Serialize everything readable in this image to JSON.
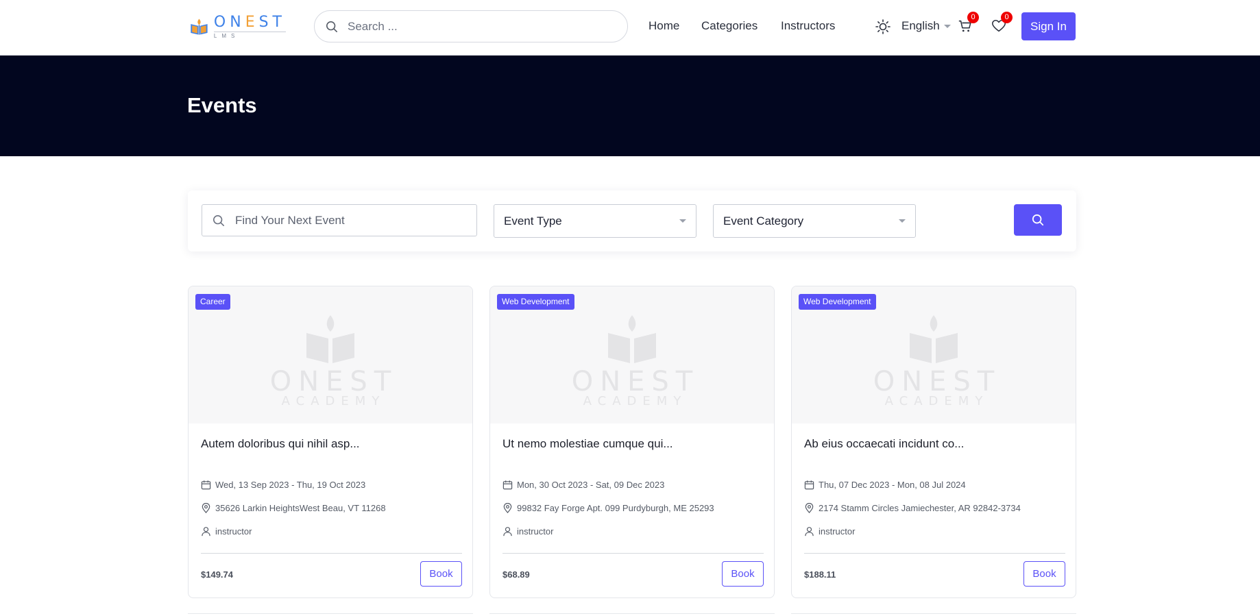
{
  "header": {
    "logo": {
      "name_left": "ON",
      "name_accent": "E",
      "name_right": "ST",
      "sub": "LMS"
    },
    "search_placeholder": "Search ...",
    "nav": {
      "home": "Home",
      "categories": "Categories",
      "instructors": "Instructors"
    },
    "language": "English",
    "cart_count": "0",
    "wishlist_count": "0",
    "sign_in": "Sign In"
  },
  "hero": {
    "title": "Events"
  },
  "filter": {
    "search_placeholder": "Find Your Next Event",
    "event_type": "Event Type",
    "event_category": "Event Category"
  },
  "placeholder_image": {
    "name": "ONEST",
    "sub": "ACADEMY"
  },
  "events": [
    {
      "tag": "Career",
      "title": "Autem doloribus qui nihil asp...",
      "dates": "Wed, 13 Sep 2023 - Thu, 19 Oct 2023",
      "location": "35626 Larkin HeightsWest Beau, VT 11268",
      "instructor": "instructor",
      "price": "$149.74",
      "book": "Book"
    },
    {
      "tag": "Web Development",
      "title": "Ut nemo molestiae cumque qui...",
      "dates": "Mon, 30 Oct 2023 - Sat, 09 Dec 2023",
      "location": "99832 Fay Forge Apt. 099 Purdyburgh, ME 25293",
      "instructor": "instructor",
      "price": "$68.89",
      "book": "Book"
    },
    {
      "tag": "Web Development",
      "title": "Ab eius occaecati incidunt co...",
      "dates": "Thu, 07 Dec 2023 - Mon, 08 Jul 2024",
      "location": "2174 Stamm Circles Jamiechester, AR 92842-3734",
      "instructor": "instructor",
      "price": "$188.11",
      "book": "Book"
    }
  ],
  "colors": {
    "accent": "#5a51f7",
    "hero_bg": "#02061f",
    "badge": "#ee0000",
    "logo_blue": "#3f82e8",
    "logo_orange": "#f2a036"
  },
  "icons": [
    "search-icon",
    "sun-icon",
    "cart-icon",
    "heart-icon",
    "calendar-icon",
    "location-pin-icon",
    "user-icon"
  ]
}
